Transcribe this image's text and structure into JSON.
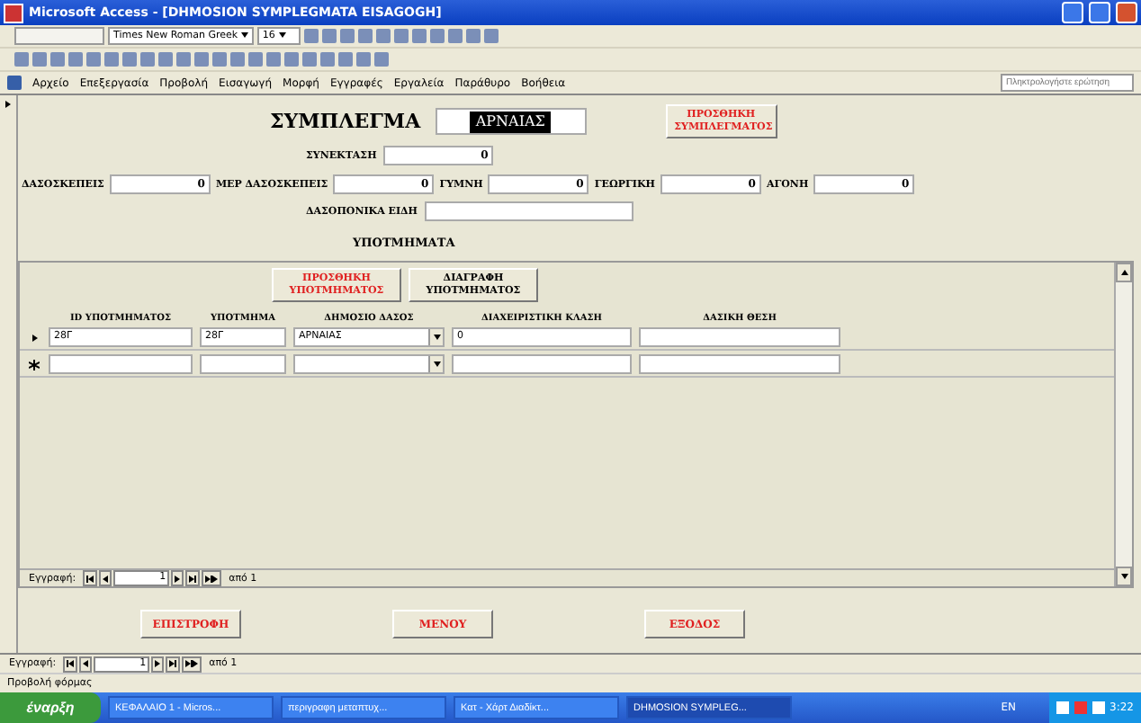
{
  "window": {
    "title": "Microsoft Access - [DHMOSION SYMPLEGMATA EISAGOGH]"
  },
  "format_toolbar": {
    "font": "Times New Roman Greek",
    "size": "16"
  },
  "menu": [
    "Αρχείο",
    "Επεξεργασία",
    "Προβολή",
    "Εισαγωγή",
    "Μορφή",
    "Εγγραφές",
    "Εργαλεία",
    "Παράθυρο",
    "Βοήθεια"
  ],
  "help_box": {
    "placeholder": "Πληκτρολογήστε ερώτηση"
  },
  "form": {
    "heading": "ΣΥΜΠΛΕΓΜΑ",
    "complex_value": "ΑΡΝΑΙΑΣ",
    "add_button": "ΠΡΟΣΘΗΚΗ ΣΥΜΠΛΕΓΜΑΤΟΣ",
    "area_label": "ΣΥΝΕΚΤΑΣΗ",
    "area_value": "0",
    "cover_fields": [
      {
        "label": "ΔΑΣΟΣΚΕΠΕΙΣ",
        "value": "0"
      },
      {
        "label": "ΜΕΡ ΔΑΣΟΣΚΕΠΕΙΣ",
        "value": "0"
      },
      {
        "label": "ΓΥΜΝΗ",
        "value": "0"
      },
      {
        "label": "ΓΕΩΡΓΙΚΗ",
        "value": "0"
      },
      {
        "label": "ΑΓΟΝΗ",
        "value": "0"
      }
    ],
    "species_label": "ΔΑΣΟΠΟΝΙΚΑ ΕΙΔΗ",
    "subsection_title": "ΥΠΟΤΜΗΜΑΤΑ"
  },
  "subform": {
    "add_button": "ΠΡΟΣΘΗΚΗ ΥΠΟΤΜΗΜΑΤΟΣ",
    "delete_button": "ΔΙΑΓΡΑΦΗ ΥΠΟΤΜΗΜΑΤΟΣ",
    "columns": [
      "ID ΥΠΟΤΜΗΜΑΤΟΣ",
      "ΥΠΟΤΜΗΜΑ",
      "ΔΗΜΟΣΙΟ ΔΑΣΟΣ",
      "ΔΙΑΧΕΙΡΙΣΤΙΚΗ ΚΛΑΣΗ",
      "ΔΑΣΙΚΗ ΘΕΣΗ"
    ],
    "rows": [
      {
        "kind": "current",
        "cells": [
          "28Γ",
          "28Γ",
          "ΑΡΝΑΙΑΣ",
          "0",
          ""
        ]
      },
      {
        "kind": "new",
        "cells": [
          "",
          "",
          "",
          "",
          ""
        ]
      }
    ],
    "nav": {
      "label": "Εγγραφή:",
      "record": "1",
      "of": "από 1"
    }
  },
  "bottom_buttons": [
    "ΕΠΙΣΤΡΟΦΗ",
    "ΜΕΝΟΥ",
    "ΕΞΟΔΟΣ"
  ],
  "nav": {
    "label": "Εγγραφή:",
    "record": "1",
    "of": "από 1"
  },
  "status_bar": "Προβολή φόρμας",
  "taskbar": {
    "start": "έναρξη",
    "tasks": [
      {
        "label": "ΚΕΦΑΛΑΙΟ 1 - Micros...",
        "selected": false
      },
      {
        "label": "περιγραφη μεταπτυχ...",
        "selected": false
      },
      {
        "label": "Κατ - Χάρτ Διαδίκτ...",
        "selected": false
      },
      {
        "label": "DHMOSION SYMPLEG...",
        "selected": true
      }
    ],
    "lang": "EN",
    "clock": "3:22"
  }
}
